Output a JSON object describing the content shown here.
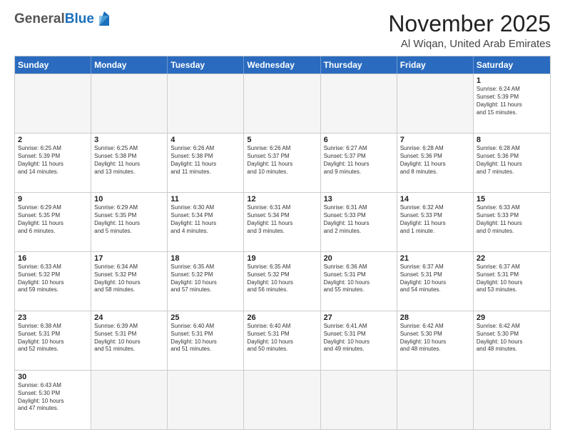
{
  "header": {
    "logo_general": "General",
    "logo_blue": "Blue",
    "month_title": "November 2025",
    "location": "Al Wiqan, United Arab Emirates"
  },
  "calendar": {
    "days_of_week": [
      "Sunday",
      "Monday",
      "Tuesday",
      "Wednesday",
      "Thursday",
      "Friday",
      "Saturday"
    ],
    "rows": [
      [
        {
          "day": "",
          "empty": true
        },
        {
          "day": "",
          "empty": true
        },
        {
          "day": "",
          "empty": true
        },
        {
          "day": "",
          "empty": true
        },
        {
          "day": "",
          "empty": true
        },
        {
          "day": "",
          "empty": true
        },
        {
          "day": "1",
          "info": "Sunrise: 6:24 AM\nSunset: 5:39 PM\nDaylight: 11 hours\nand 15 minutes."
        }
      ],
      [
        {
          "day": "2",
          "info": "Sunrise: 6:25 AM\nSunset: 5:39 PM\nDaylight: 11 hours\nand 14 minutes."
        },
        {
          "day": "3",
          "info": "Sunrise: 6:25 AM\nSunset: 5:38 PM\nDaylight: 11 hours\nand 13 minutes."
        },
        {
          "day": "4",
          "info": "Sunrise: 6:26 AM\nSunset: 5:38 PM\nDaylight: 11 hours\nand 11 minutes."
        },
        {
          "day": "5",
          "info": "Sunrise: 6:26 AM\nSunset: 5:37 PM\nDaylight: 11 hours\nand 10 minutes."
        },
        {
          "day": "6",
          "info": "Sunrise: 6:27 AM\nSunset: 5:37 PM\nDaylight: 11 hours\nand 9 minutes."
        },
        {
          "day": "7",
          "info": "Sunrise: 6:28 AM\nSunset: 5:36 PM\nDaylight: 11 hours\nand 8 minutes."
        },
        {
          "day": "8",
          "info": "Sunrise: 6:28 AM\nSunset: 5:36 PM\nDaylight: 11 hours\nand 7 minutes."
        }
      ],
      [
        {
          "day": "9",
          "info": "Sunrise: 6:29 AM\nSunset: 5:35 PM\nDaylight: 11 hours\nand 6 minutes."
        },
        {
          "day": "10",
          "info": "Sunrise: 6:29 AM\nSunset: 5:35 PM\nDaylight: 11 hours\nand 5 minutes."
        },
        {
          "day": "11",
          "info": "Sunrise: 6:30 AM\nSunset: 5:34 PM\nDaylight: 11 hours\nand 4 minutes."
        },
        {
          "day": "12",
          "info": "Sunrise: 6:31 AM\nSunset: 5:34 PM\nDaylight: 11 hours\nand 3 minutes."
        },
        {
          "day": "13",
          "info": "Sunrise: 6:31 AM\nSunset: 5:33 PM\nDaylight: 11 hours\nand 2 minutes."
        },
        {
          "day": "14",
          "info": "Sunrise: 6:32 AM\nSunset: 5:33 PM\nDaylight: 11 hours\nand 1 minute."
        },
        {
          "day": "15",
          "info": "Sunrise: 6:33 AM\nSunset: 5:33 PM\nDaylight: 11 hours\nand 0 minutes."
        }
      ],
      [
        {
          "day": "16",
          "info": "Sunrise: 6:33 AM\nSunset: 5:32 PM\nDaylight: 10 hours\nand 59 minutes."
        },
        {
          "day": "17",
          "info": "Sunrise: 6:34 AM\nSunset: 5:32 PM\nDaylight: 10 hours\nand 58 minutes."
        },
        {
          "day": "18",
          "info": "Sunrise: 6:35 AM\nSunset: 5:32 PM\nDaylight: 10 hours\nand 57 minutes."
        },
        {
          "day": "19",
          "info": "Sunrise: 6:35 AM\nSunset: 5:32 PM\nDaylight: 10 hours\nand 56 minutes."
        },
        {
          "day": "20",
          "info": "Sunrise: 6:36 AM\nSunset: 5:31 PM\nDaylight: 10 hours\nand 55 minutes."
        },
        {
          "day": "21",
          "info": "Sunrise: 6:37 AM\nSunset: 5:31 PM\nDaylight: 10 hours\nand 54 minutes."
        },
        {
          "day": "22",
          "info": "Sunrise: 6:37 AM\nSunset: 5:31 PM\nDaylight: 10 hours\nand 53 minutes."
        }
      ],
      [
        {
          "day": "23",
          "info": "Sunrise: 6:38 AM\nSunset: 5:31 PM\nDaylight: 10 hours\nand 52 minutes."
        },
        {
          "day": "24",
          "info": "Sunrise: 6:39 AM\nSunset: 5:31 PM\nDaylight: 10 hours\nand 51 minutes."
        },
        {
          "day": "25",
          "info": "Sunrise: 6:40 AM\nSunset: 5:31 PM\nDaylight: 10 hours\nand 51 minutes."
        },
        {
          "day": "26",
          "info": "Sunrise: 6:40 AM\nSunset: 5:31 PM\nDaylight: 10 hours\nand 50 minutes."
        },
        {
          "day": "27",
          "info": "Sunrise: 6:41 AM\nSunset: 5:31 PM\nDaylight: 10 hours\nand 49 minutes."
        },
        {
          "day": "28",
          "info": "Sunrise: 6:42 AM\nSunset: 5:30 PM\nDaylight: 10 hours\nand 48 minutes."
        },
        {
          "day": "29",
          "info": "Sunrise: 6:42 AM\nSunset: 5:30 PM\nDaylight: 10 hours\nand 48 minutes."
        }
      ],
      [
        {
          "day": "30",
          "info": "Sunrise: 6:43 AM\nSunset: 5:30 PM\nDaylight: 10 hours\nand 47 minutes."
        },
        {
          "day": "",
          "empty": true
        },
        {
          "day": "",
          "empty": true
        },
        {
          "day": "",
          "empty": true
        },
        {
          "day": "",
          "empty": true
        },
        {
          "day": "",
          "empty": true
        },
        {
          "day": "",
          "empty": true
        }
      ]
    ]
  }
}
